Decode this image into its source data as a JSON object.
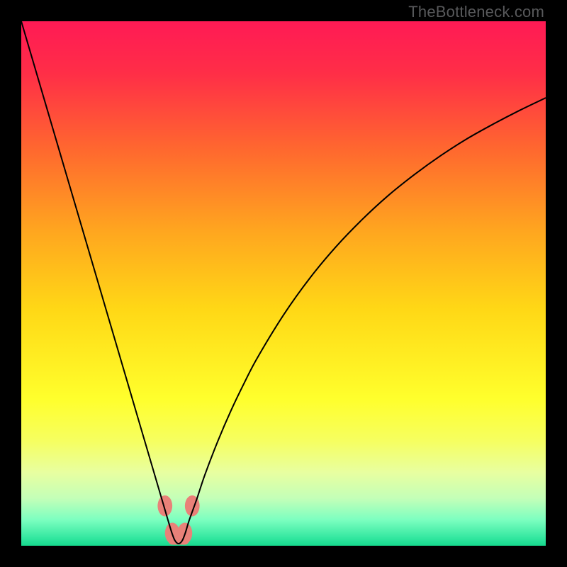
{
  "watermark": "TheBottleneck.com",
  "chart_data": {
    "type": "line",
    "title": "",
    "xlabel": "",
    "ylabel": "",
    "xlim": [
      0,
      100
    ],
    "ylim": [
      0,
      100
    ],
    "axes_visible": false,
    "grid": false,
    "background_gradient": {
      "stops": [
        {
          "offset": 0.0,
          "color": "#ff1a55"
        },
        {
          "offset": 0.1,
          "color": "#ff2e47"
        },
        {
          "offset": 0.25,
          "color": "#ff6a2e"
        },
        {
          "offset": 0.4,
          "color": "#ffa61f"
        },
        {
          "offset": 0.55,
          "color": "#ffd816"
        },
        {
          "offset": 0.72,
          "color": "#ffff2c"
        },
        {
          "offset": 0.8,
          "color": "#f6ff60"
        },
        {
          "offset": 0.86,
          "color": "#e8ffa0"
        },
        {
          "offset": 0.91,
          "color": "#c3ffb8"
        },
        {
          "offset": 0.95,
          "color": "#7dffc0"
        },
        {
          "offset": 0.985,
          "color": "#33e7a0"
        },
        {
          "offset": 1.0,
          "color": "#16d98e"
        }
      ]
    },
    "series": [
      {
        "name": "bottleneck-curve",
        "stroke": "#000000",
        "stroke_width": 2,
        "x": [
          0.0,
          2.5,
          5.0,
          7.5,
          10.0,
          12.5,
          15.0,
          17.5,
          20.0,
          22.5,
          24.0,
          25.5,
          27.0,
          28.0,
          28.7,
          29.3,
          30.0,
          30.7,
          31.3,
          32.0,
          33.5,
          35.0,
          37.5,
          40.0,
          42.5,
          45.0,
          50.0,
          55.0,
          60.0,
          65.0,
          70.0,
          75.0,
          80.0,
          85.0,
          90.0,
          95.0,
          100.0
        ],
        "y": [
          100.0,
          91.5,
          83.0,
          74.5,
          66.0,
          57.5,
          49.0,
          40.5,
          32.0,
          23.5,
          18.4,
          13.3,
          8.2,
          4.8,
          2.5,
          1.0,
          0.4,
          1.0,
          2.5,
          4.8,
          9.0,
          13.5,
          20.0,
          25.8,
          31.0,
          35.8,
          44.0,
          51.0,
          57.0,
          62.2,
          66.8,
          70.8,
          74.4,
          77.6,
          80.4,
          83.0,
          85.4
        ]
      }
    ],
    "markers": [
      {
        "name": "left-top",
        "x": 27.4,
        "y": 7.6,
        "rx": 1.4,
        "ry": 2.0,
        "fill": "#e98179"
      },
      {
        "name": "left-bottom",
        "x": 28.8,
        "y": 2.4,
        "rx": 1.4,
        "ry": 2.0,
        "fill": "#e98179"
      },
      {
        "name": "right-bottom",
        "x": 31.2,
        "y": 2.4,
        "rx": 1.4,
        "ry": 2.0,
        "fill": "#e98179"
      },
      {
        "name": "right-top",
        "x": 32.6,
        "y": 7.6,
        "rx": 1.4,
        "ry": 2.0,
        "fill": "#e98179"
      }
    ],
    "trough_band": {
      "x_start": 28.0,
      "x_end": 32.0,
      "y": 1.4,
      "height": 2.4,
      "fill": "#e98179"
    }
  }
}
